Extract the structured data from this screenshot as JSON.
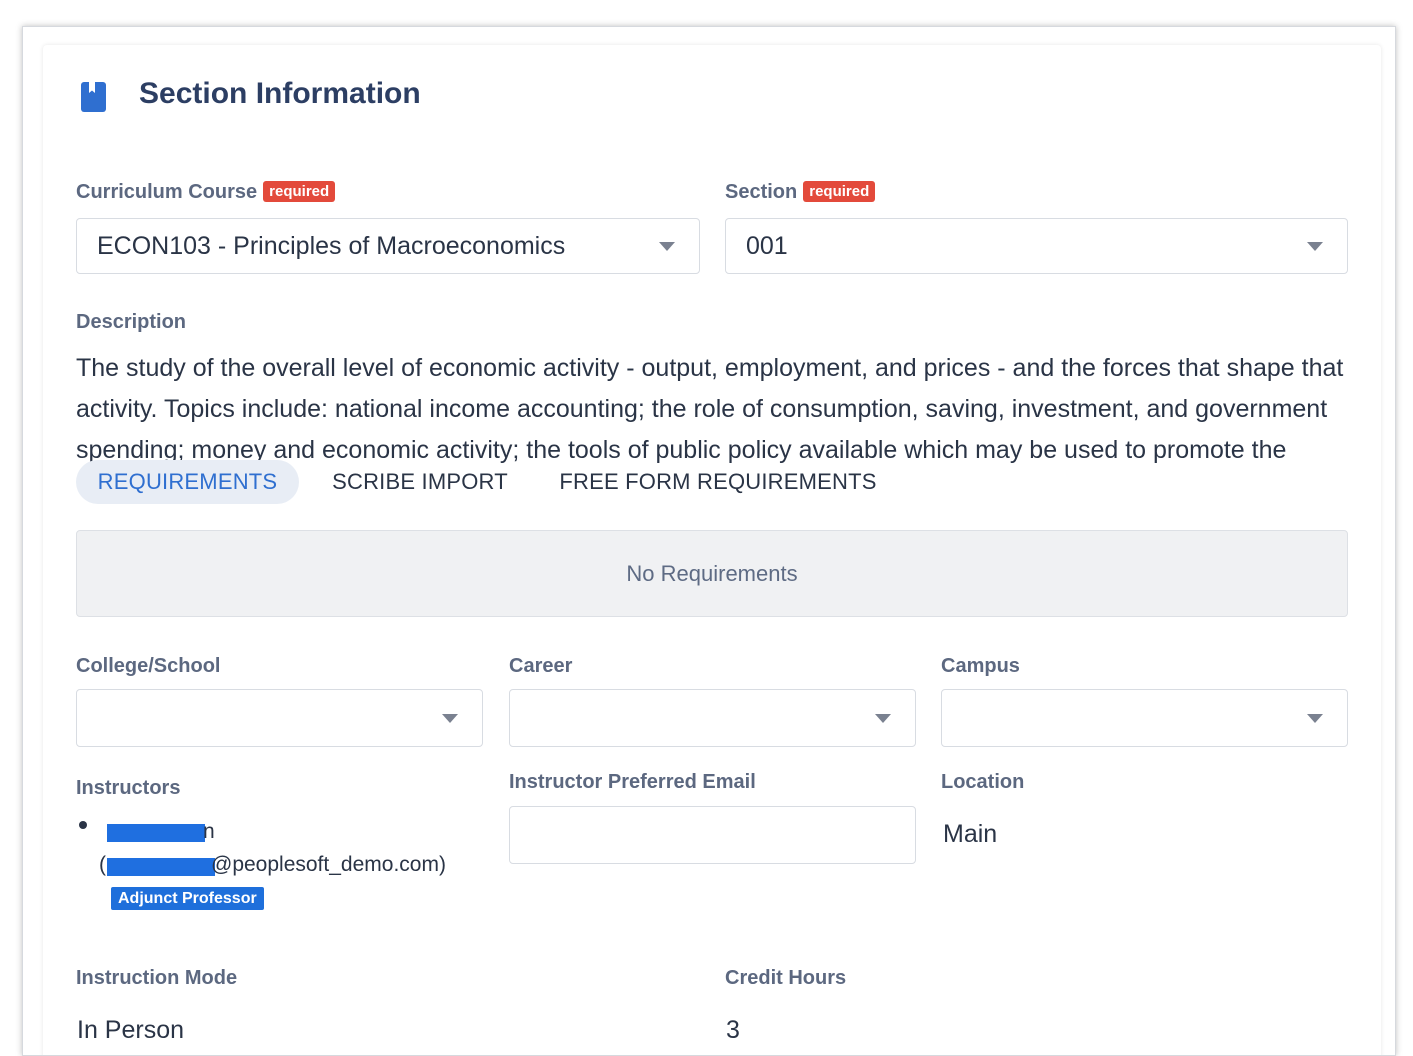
{
  "header": {
    "title": "Section Information",
    "icon": "book-icon"
  },
  "fields": {
    "curriculum_course": {
      "label": "Curriculum Course",
      "required_badge": "required",
      "value": "ECON103 - Principles of Macroeconomics"
    },
    "section": {
      "label": "Section",
      "required_badge": "required",
      "value": "001"
    },
    "description": {
      "label": "Description",
      "text": "The study of the overall level of economic activity - output, employment, and prices - and the forces that shape that activity. Topics include: national income accounting; the role of consumption, saving, investment, and government spending; money and economic activity; the tools of public policy available which may be used to promote the"
    },
    "college_school": {
      "label": "College/School",
      "value": ""
    },
    "career": {
      "label": "Career",
      "value": ""
    },
    "campus": {
      "label": "Campus",
      "value": ""
    },
    "instructors": {
      "label": "Instructors",
      "items": [
        {
          "name_tail": "n",
          "email_paren_open": "(",
          "email_tail": "@peoplesoft_demo.com)",
          "role": "Adjunct Professor"
        }
      ]
    },
    "instructor_email": {
      "label": "Instructor Preferred Email",
      "value": ""
    },
    "location": {
      "label": "Location",
      "value": "Main"
    },
    "instruction_mode": {
      "label": "Instruction Mode",
      "value": "In Person"
    },
    "credit_hours": {
      "label": "Credit Hours",
      "value": "3"
    }
  },
  "tabs": [
    {
      "label": "REQUIREMENTS",
      "active": true
    },
    {
      "label": "SCRIBE IMPORT",
      "active": false
    },
    {
      "label": "FREE FORM REQUIREMENTS",
      "active": false
    }
  ],
  "requirements_panel": {
    "empty_text": "No Requirements"
  },
  "colors": {
    "accent": "#2f6fd0",
    "required": "#e34a3b",
    "title": "#2c3e63",
    "chip": "#1e6fdb"
  }
}
